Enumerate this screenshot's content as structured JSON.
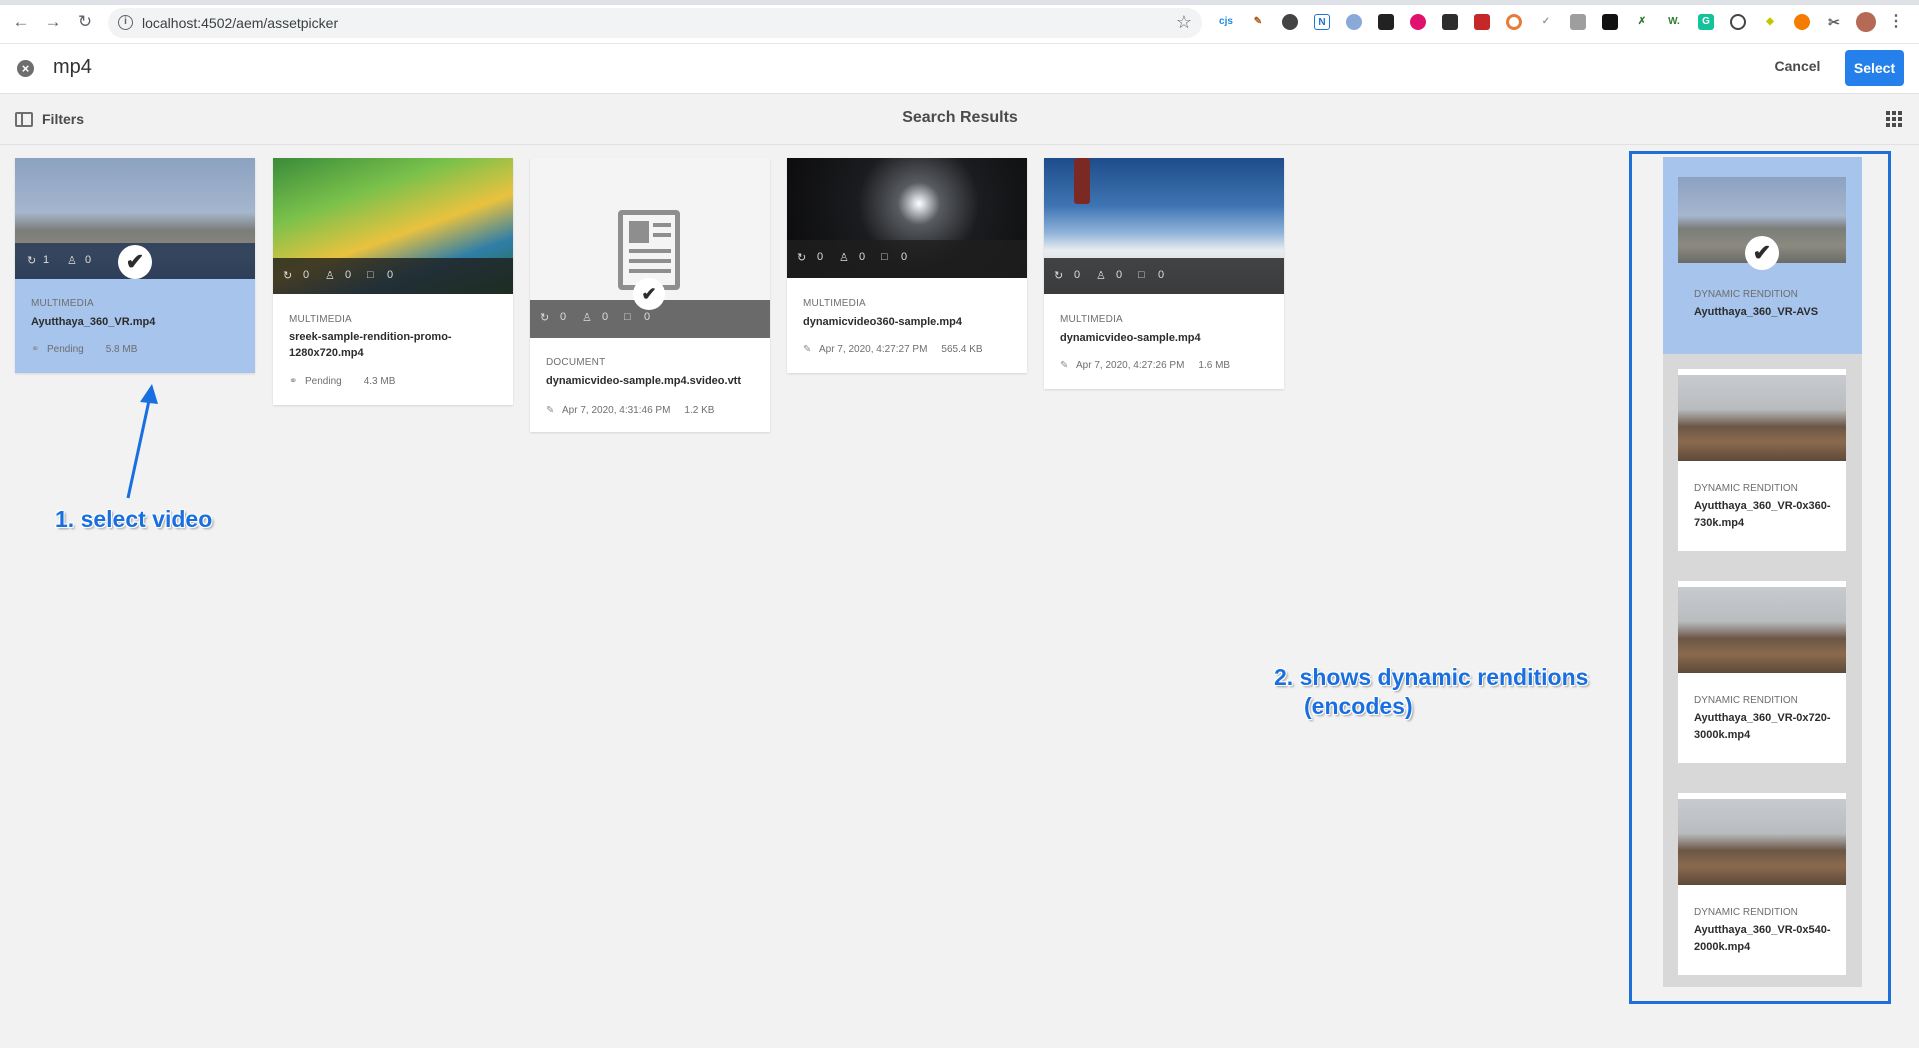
{
  "browser": {
    "url": "localhost:4502/aem/assetpicker"
  },
  "header": {
    "search_value": "mp4",
    "cancel_label": "Cancel",
    "select_label": "Select"
  },
  "toolbar": {
    "filters_label": "Filters",
    "title": "Search Results"
  },
  "cards": [
    {
      "type": "MULTIMEDIA",
      "name": "Ayutthaya_360_VR.mp4",
      "status": "Pending",
      "size": "5.8 MB",
      "stats": [
        "1",
        "0",
        "0"
      ],
      "selected": true
    },
    {
      "type": "MULTIMEDIA",
      "name": "sreek-sample-rendition-promo-1280x720.mp4",
      "status": "Pending",
      "size": "4.3 MB",
      "stats": [
        "0",
        "0",
        "0"
      ],
      "selected": false
    },
    {
      "type": "DOCUMENT",
      "name": "dynamicvideo-sample.mp4.svideo.vtt",
      "date": "Apr 7, 2020, 4:31:46 PM",
      "size": "1.2 KB",
      "stats": [
        "0",
        "0",
        "0"
      ],
      "selected": false
    },
    {
      "type": "MULTIMEDIA",
      "name": "dynamicvideo360-sample.mp4",
      "date": "Apr 7, 2020, 4:27:27 PM",
      "size": "565.4 KB",
      "stats": [
        "0",
        "0",
        "0"
      ],
      "selected": false
    },
    {
      "type": "MULTIMEDIA",
      "name": "dynamicvideo-sample.mp4",
      "date": "Apr 7, 2020, 4:27:26 PM",
      "size": "1.6 MB",
      "stats": [
        "0",
        "0",
        "0"
      ],
      "selected": false
    }
  ],
  "renditions": [
    {
      "type": "DYNAMIC RENDITION",
      "name": "Ayutthaya_360_VR-AVS",
      "selected": true
    },
    {
      "type": "DYNAMIC RENDITION",
      "name": "Ayutthaya_360_VR-0x360-730k.mp4",
      "selected": false
    },
    {
      "type": "DYNAMIC RENDITION",
      "name": "Ayutthaya_360_VR-0x720-3000k.mp4",
      "selected": false
    },
    {
      "type": "DYNAMIC RENDITION",
      "name": "Ayutthaya_360_VR-0x540-2000k.mp4",
      "selected": false
    }
  ],
  "annotations": {
    "step1": "1. select video",
    "step2_line1": "2. shows dynamic renditions",
    "step2_line2": "(encodes)"
  },
  "colors": {
    "accent": "#2680eb",
    "selected_card": "#a6c4ec",
    "annotation": "#1a6fe0"
  }
}
